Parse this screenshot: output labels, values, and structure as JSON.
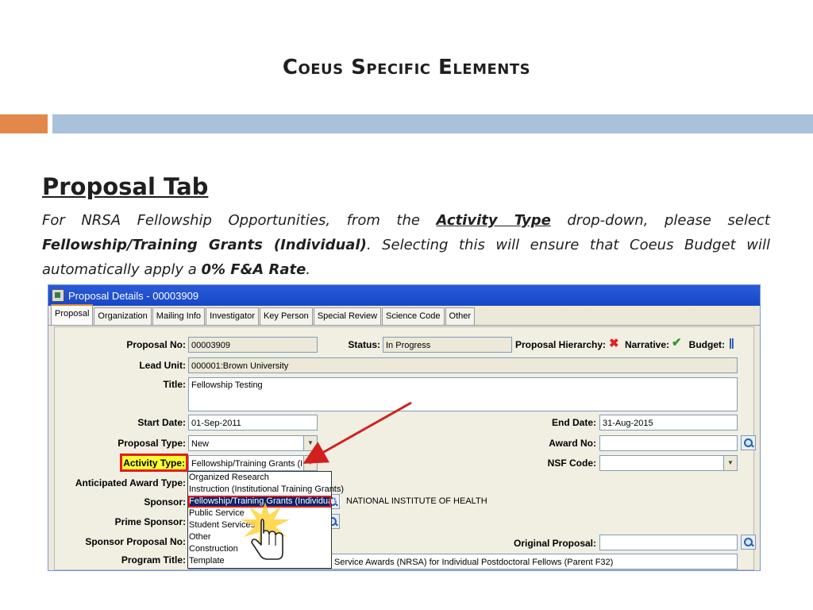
{
  "slide": {
    "title": "Coeus Specific Elements",
    "heading": "Proposal Tab",
    "para_1": "For NRSA Fellowship Opportunities, from the ",
    "para_activity": "Activity Type",
    "para_2": " drop-down, please select ",
    "para_fellowship": "Fellowship/Training Grants (Individual)",
    "para_3": ". Selecting this will ensure that Coeus Budget will automatically apply a ",
    "para_rate": "0% F&A Rate",
    "para_4": "."
  },
  "colors": {
    "accent_orange": "#e2884a",
    "accent_blue": "#a9c1d9",
    "highlight_red": "#e21c1c",
    "highlight_yellow": "#ffff33"
  },
  "window": {
    "title": "Proposal Details - 00003909",
    "tabs": [
      "Proposal",
      "Organization",
      "Mailing Info",
      "Investigator",
      "Key Person",
      "Special Review",
      "Science Code",
      "Other"
    ],
    "active_tab": "Proposal"
  },
  "form": {
    "proposal_no_label": "Proposal No:",
    "proposal_no": "00003909",
    "status_label": "Status:",
    "status": "In Progress",
    "hierarchy_label": "Proposal Hierarchy:",
    "narrative_label": "Narrative:",
    "budget_label": "Budget:",
    "lead_unit_label": "Lead Unit:",
    "lead_unit": "000001:Brown University",
    "title_label": "Title:",
    "title": "Fellowship Testing",
    "start_date_label": "Start Date:",
    "start_date": "01-Sep-2011",
    "end_date_label": "End Date:",
    "end_date": "31-Aug-2015",
    "proposal_type_label": "Proposal Type:",
    "proposal_type": "New",
    "award_no_label": "Award No:",
    "award_no": "",
    "activity_type_label": "Activity Type:",
    "activity_type": "Fellowship/Training Grants (In...",
    "nsf_code_label": "NSF Code:",
    "nsf_code": "",
    "anticipated_award_label": "Anticipated Award Type:",
    "sponsor_label": "Sponsor:",
    "sponsor_name": "NATIONAL INSTITUTE OF HEALTH",
    "prime_sponsor_label": "Prime Sponsor:",
    "sponsor_proposal_label": "Sponsor Proposal No:",
    "original_proposal_label": "Original Proposal:",
    "original_proposal": "",
    "program_title_label": "Program Title:",
    "program_title": "Service Awards (NRSA) for Individual Postdoctoral Fellows (Parent F32)"
  },
  "activity_dropdown": {
    "options": [
      "Organized Research",
      "Instruction (Institutional Training Grants)",
      "Fellowship/Training Grants (Individuals)",
      "Public Service",
      "Student Services",
      "Other",
      "Construction",
      "Template"
    ],
    "selected": "Fellowship/Training Grants (Individuals)"
  },
  "icons": {
    "hierarchy": "red-x-icon",
    "narrative": "green-check-icon",
    "budget": "blue-bars-icon",
    "lookup": "magnifier-icon",
    "pointer": "hand-cursor-icon"
  }
}
